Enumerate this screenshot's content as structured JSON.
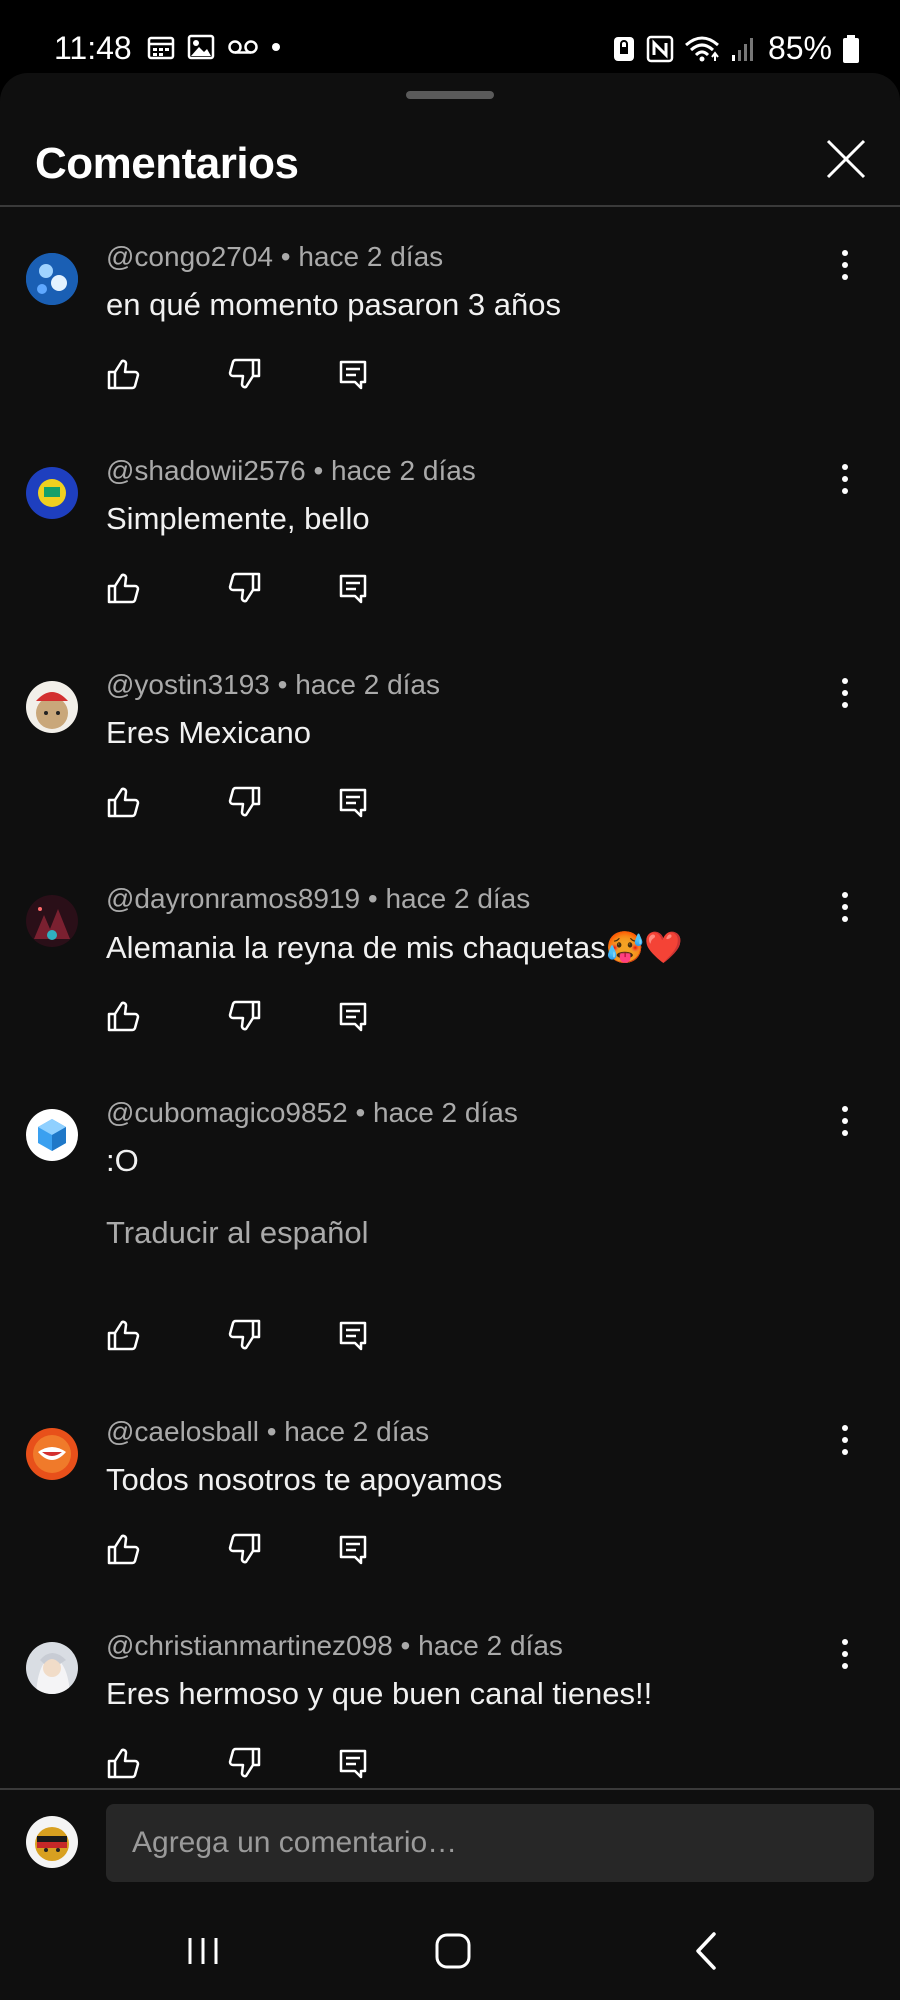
{
  "status_bar": {
    "time": "11:48",
    "battery": "85%",
    "left_icons": [
      "calendar-icon",
      "gallery-icon",
      "voicemail-icon",
      "dot-icon"
    ],
    "right_icons": [
      "lock-app-icon",
      "nfc-icon",
      "wifi-icon",
      "signal-icon",
      "battery-icon"
    ]
  },
  "sheet": {
    "title": "Comentarios",
    "close_icon": "close-icon"
  },
  "comments": [
    {
      "author": "@congo2704 • hace 2 días",
      "text": "en qué momento pasaron 3 años",
      "avatar_color": "#1a5fb4"
    },
    {
      "author": "@shadowii2576 • hace 2 días",
      "text": "Simplemente, bello",
      "avatar_color": "#1e3fbf"
    },
    {
      "author": "@yostin3193 • hace 2 días",
      "text": "Eres Mexicano",
      "avatar_color": "#c9a77a"
    },
    {
      "author": "@dayronramos8919 • hace 2 días",
      "text": "Alemania la reyna de mis chaquetas🥵❤️",
      "avatar_color": "#4a1f2a"
    },
    {
      "author": "@cubomagico9852 • hace 2 días",
      "text": ":O",
      "translate": "Traducir al español",
      "avatar_color": "#ffffff"
    },
    {
      "author": "@caelosball • hace 2 días",
      "text": "Todos nosotros te apoyamos",
      "avatar_color": "#e8501a"
    },
    {
      "author": "@christianmartinez098 • hace 2 días",
      "text": "Eres hermoso y que buen canal tienes!!",
      "avatar_color": "#d9dde3"
    }
  ],
  "composer": {
    "placeholder": "Agrega un comentario…"
  },
  "nav": {
    "icons": [
      "recent-apps-icon",
      "home-icon",
      "back-icon"
    ]
  },
  "colors": {
    "background": "#0f0f0f",
    "text_primary": "#f1f1f1",
    "text_secondary": "#aaaaaa",
    "divider": "#3a3a3a"
  }
}
